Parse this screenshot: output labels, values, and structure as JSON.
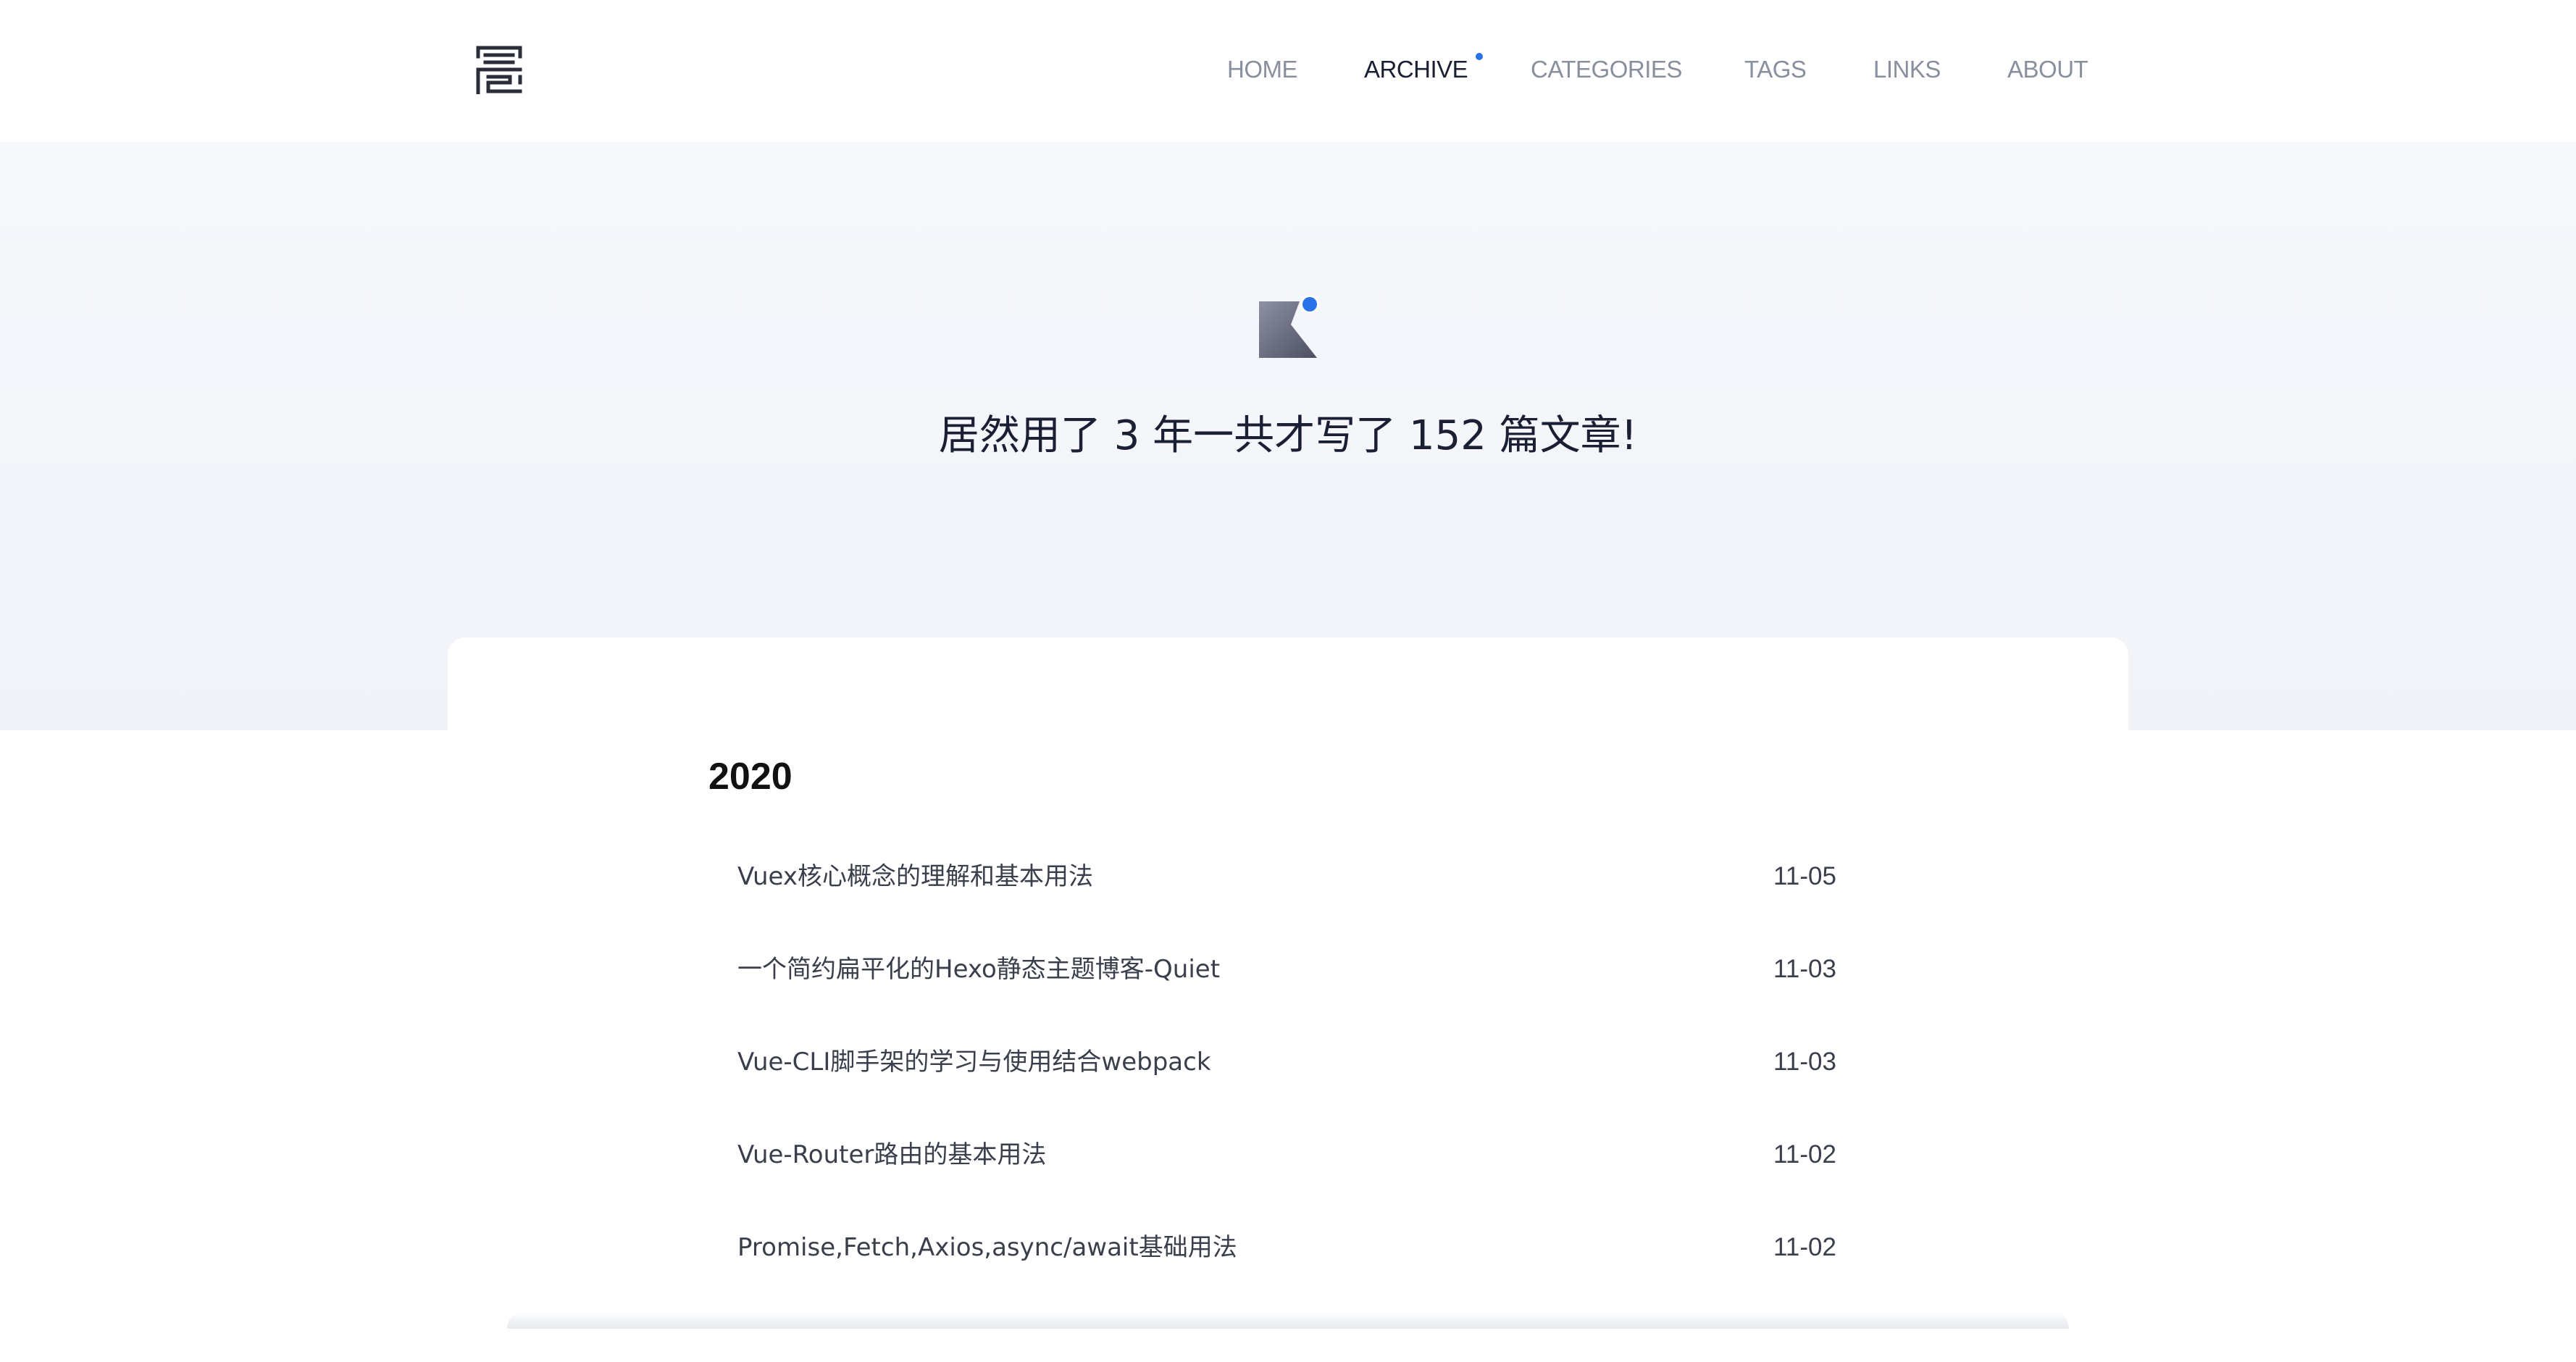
{
  "header": {
    "logo_icon": "seal-glyph-icon",
    "nav": [
      {
        "label": "HOME",
        "active": false
      },
      {
        "label": "ARCHIVE",
        "active": true
      },
      {
        "label": "CATEGORIES",
        "active": false
      },
      {
        "label": "TAGS",
        "active": false
      },
      {
        "label": "LINKS",
        "active": false
      },
      {
        "label": "ABOUT",
        "active": false
      }
    ],
    "active_indicator_color": "#2a72e8"
  },
  "hero": {
    "icon": "archive-badge-icon",
    "title": "居然用了 3 年一共才写了 152 篇文章!"
  },
  "archive": {
    "year": "2020",
    "posts": [
      {
        "title": "Vuex核心概念的理解和基本用法",
        "date": "11-05"
      },
      {
        "title": "一个简约扁平化的Hexo静态主题博客-Quiet",
        "date": "11-03"
      },
      {
        "title": "Vue-CLI脚手架的学习与使用结合webpack",
        "date": "11-03"
      },
      {
        "title": "Vue-Router路由的基本用法",
        "date": "11-02"
      },
      {
        "title": "Promise,Fetch,Axios,async/await基础用法",
        "date": "11-02"
      }
    ]
  },
  "colors": {
    "accent": "#2a72e8",
    "text_dark": "#1b1f33",
    "nav_inactive": "#8a8f9e",
    "hero_background": "#f4f6fb"
  }
}
